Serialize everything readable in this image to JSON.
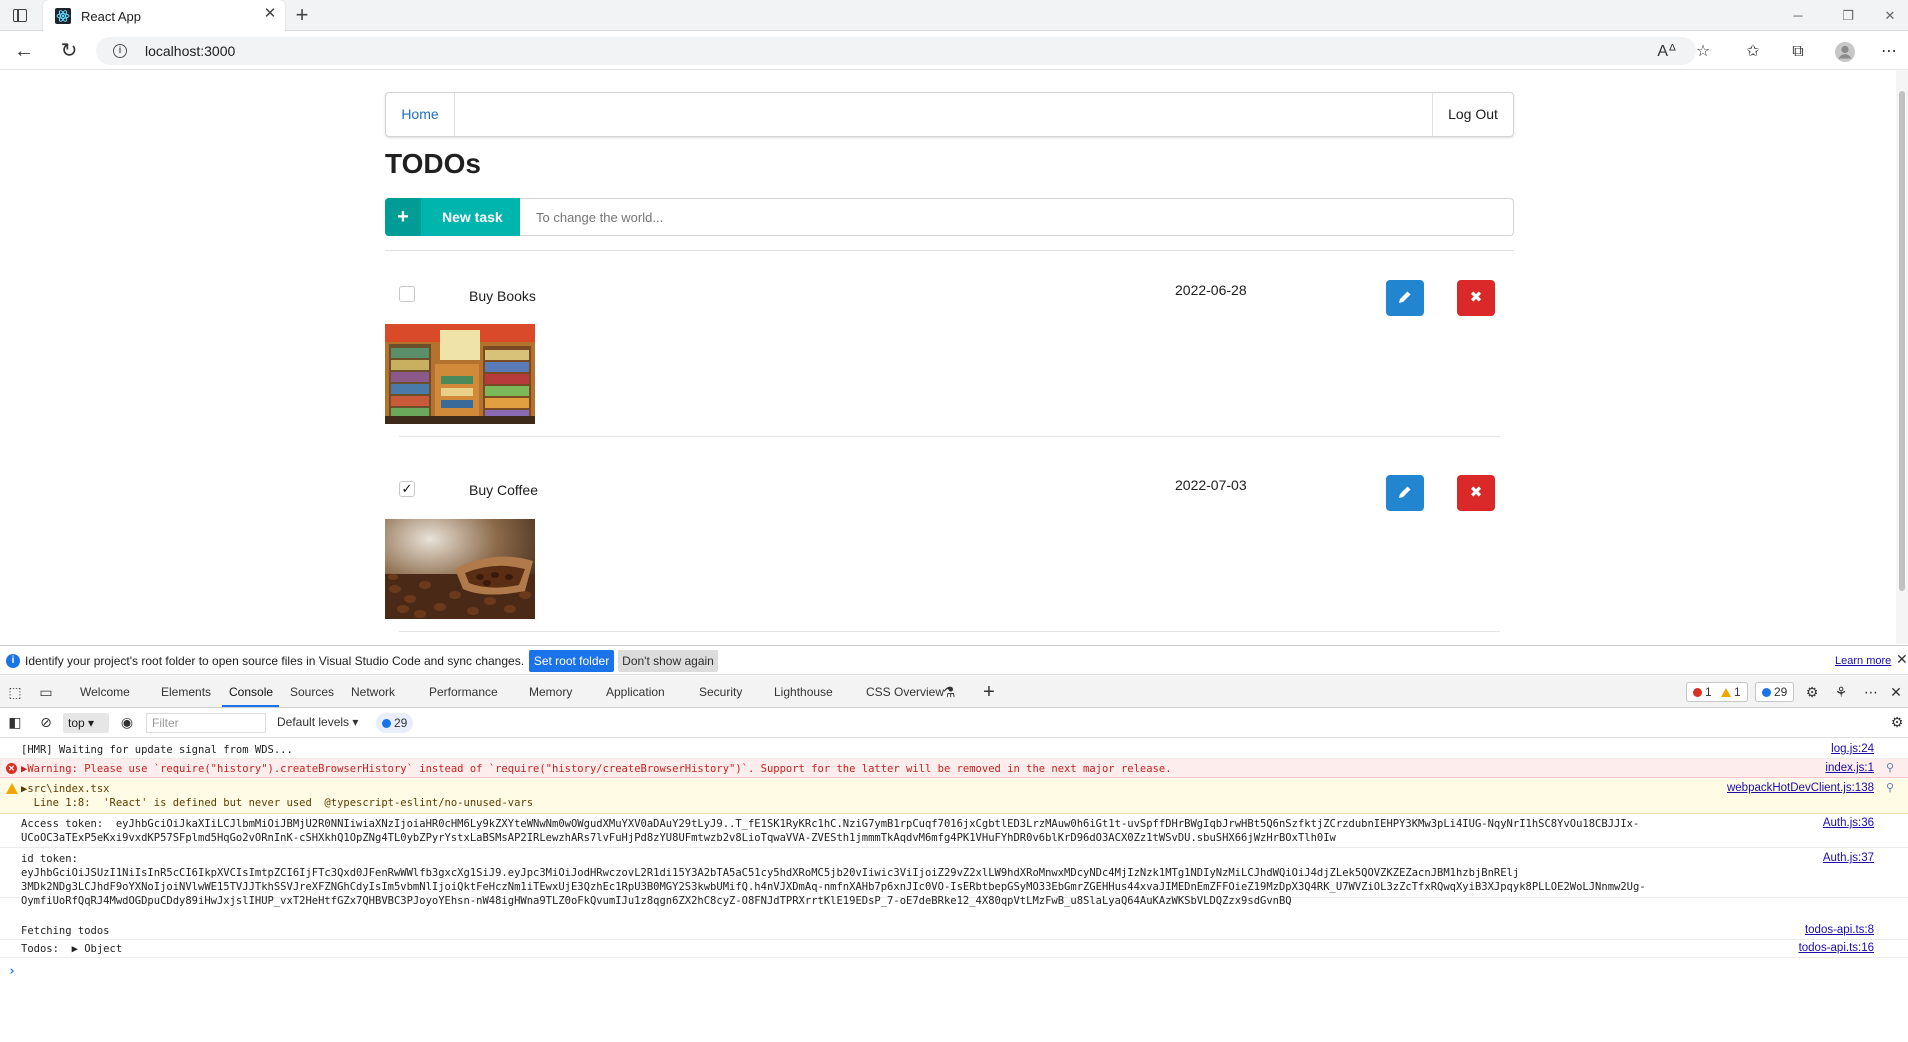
{
  "browser": {
    "tab_title": "React App",
    "url": "localhost:3000"
  },
  "menu": {
    "home": "Home",
    "logout": "Log Out"
  },
  "page": {
    "title": "TODOs",
    "new_task_label": "New task",
    "input_placeholder": "To change the world..."
  },
  "todos": [
    {
      "name": "Buy Books",
      "date": "2022-06-28",
      "done": false,
      "image": "bookstore-shelves"
    },
    {
      "name": "Buy Coffee",
      "date": "2022-07-03",
      "done": true,
      "image": "coffee-beans-scoop"
    }
  ],
  "devtools": {
    "infobar_message": "Identify your project's root folder to open source files in Visual Studio Code and sync changes.",
    "set_root_folder": "Set root folder",
    "dont_show_again": "Don't show again",
    "learn_more": "Learn more",
    "tabs": [
      "Welcome",
      "Elements",
      "Console",
      "Sources",
      "Network",
      "Performance",
      "Memory",
      "Application",
      "Security",
      "Lighthouse",
      "CSS Overview"
    ],
    "active_tab": "Console",
    "error_count": "1",
    "warning_count": "1",
    "message_count": "29",
    "context": "top",
    "filter_placeholder": "Filter",
    "levels": "Default levels",
    "levels_count": "29",
    "colors": {
      "accent": "#1a73e8",
      "teal": "#00b5ad",
      "edit_blue": "#2185d0",
      "delete_red": "#db2828"
    }
  },
  "console": {
    "lines": [
      {
        "type": "log",
        "text": "[HMR] Waiting for update signal from WDS...",
        "source": "log.js:24"
      },
      {
        "type": "error",
        "text": "▶Warning: Please use `require(\"history\").createBrowserHistory` instead of `require(\"history/createBrowserHistory\")`. Support for the latter will be removed in the next major release.",
        "source": "index.js:1"
      },
      {
        "type": "warn",
        "text": "▶src\\index.tsx\n  Line 1:8:  'React' is defined but never used  @typescript-eslint/no-unused-vars",
        "source": "webpackHotDevClient.js:138"
      },
      {
        "type": "log",
        "text": "Access token:  eyJhbGciOiJkaXIiLCJlbmMiOiJBMjU2R0NNIiwiaXNzIjoiaHR0cHM6Ly9kZXYteWNwNm0wOWgudXMuYXV0aDAuY29tLyJ9..T_fE1SK1RyKRc1hC.NziG7ymB1rpCuqf7016jxCgbtlED3LrzMAuw0h6iGt1t-uvSpffDHrBWgIqbJrwHBt5Q6nSzfktjZCrzdubnIEHPY3KMw3pLi4IUG-NqyNrI1hSC8YvOu18CBJJIx-\nUCoOC3aTExP5eKxi9vxdKP57SFplmd5HqGo2vORnInK-cSHXkhQ1OpZNg4TL0ybZPyrYstxLaBSMsAP2IRLewzhARs7lvFuHjPd8zYU8UFmtwzb2v8LioTqwaVVA-ZVESth1jmmmTkAqdvM6mfg4PK1VHuFYhDR0v6blKrD96dO3ACX0Zz1tWSvDU.sbuSHX66jWzHrBOxTlh0Iw",
        "source": "Auth.js:36"
      },
      {
        "type": "log",
        "text": "id token:\neyJhbGciOiJSUzI1NiIsInR5cCI6IkpXVCIsImtpZCI6IjFTc3Qxd0JFenRwWWlfb3gxcXg1SiJ9.eyJpc3MiOiJodHRwczovL2R1di15Y3A2bTA5aC51cy5hdXRoMC5jb20vIiwic3ViIjoiZ29vZ2xlLW9hdXRoMnwxMDcyNDc4MjIzNzk1MTg1NDIyNzMiLCJhdWQiOiJ4djZLek5QOVZKZEZacnJBM1hzbjBnRElj\n3MDk2NDg3LCJhdF9oYXNoIjoiNVlwWE15TVJJTkhSSVJreXFZNGhCdyIsIm5vbmNlIjoiQktFeHczNm1iTEwxUjE3QzhEc1RpU3B0MGY2S3kwbUMifQ.h4nVJXDmAq-nmfnXAHb7p6xnJIc0VO-IsERbtbepGSyMO33EbGmrZGEHHus44xvaJIMEDnEmZFFOieZ19MzDpX3Q4RK_U7WVZiOL3zZcTfxRQwqXyiB3XJpqyk8PLLOE2WoLJNnmw2Ug-\nOymfiUoRfQqRJ4MwdOGDpuCDdy89iHwJxjslIHUP_vxT2HeHtfGZx7QHBVBC3PJoyoYEhsn-nW48igHWna9TLZ0oFkQvumIJu1z8qgn6ZX2hC8cyZ-O8FNJdTPRXrrtKlE19EDsP_7-oE7deBRke12_4X80qpVtLMzFwB_u8SlaLyaQ64AuKAzWKSbVLDQZzx9sdGvnBQ",
        "source": "Auth.js:37"
      },
      {
        "type": "log",
        "text": "Fetching todos",
        "source": "todos-api.ts:8"
      },
      {
        "type": "log",
        "text": "Todos:  ▶ Object",
        "source": "todos-api.ts:16"
      }
    ]
  }
}
